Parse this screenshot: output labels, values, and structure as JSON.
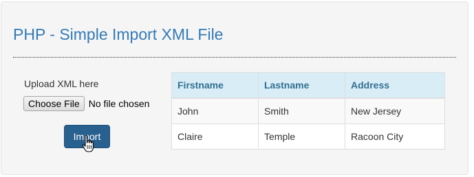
{
  "page": {
    "title": "PHP - Simple Import XML File"
  },
  "upload": {
    "label": "Upload XML here",
    "choose_button": "Choose File",
    "file_status": "No file chosen",
    "import_button": "Import"
  },
  "table": {
    "headers": [
      "Firstname",
      "Lastname",
      "Address"
    ],
    "rows": [
      [
        "John",
        "Smith",
        "New Jersey"
      ],
      [
        "Claire",
        "Temple",
        "Racoon City"
      ]
    ]
  },
  "colors": {
    "title": "#337ab7",
    "import_button_bg": "#286090",
    "table_header_bg": "#d9edf7",
    "table_header_text": "#31708f"
  },
  "icons": {
    "cursor": "hand-pointer-icon"
  }
}
